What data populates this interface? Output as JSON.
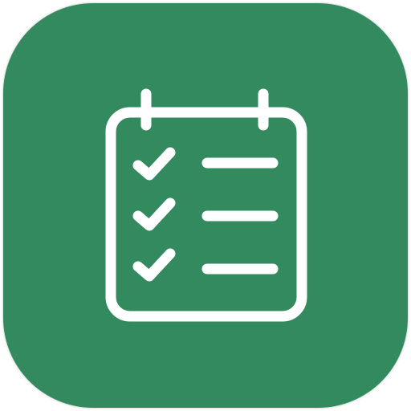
{
  "app_icon": {
    "icon": "checklist-clipboard-icon",
    "background_color": "#338a5f",
    "foreground_color": "#ffffff",
    "checklist": {
      "items": [
        {
          "icon": "checkmark-icon",
          "checked": true
        },
        {
          "icon": "checkmark-icon",
          "checked": true
        },
        {
          "icon": "checkmark-icon",
          "checked": true
        }
      ]
    }
  }
}
